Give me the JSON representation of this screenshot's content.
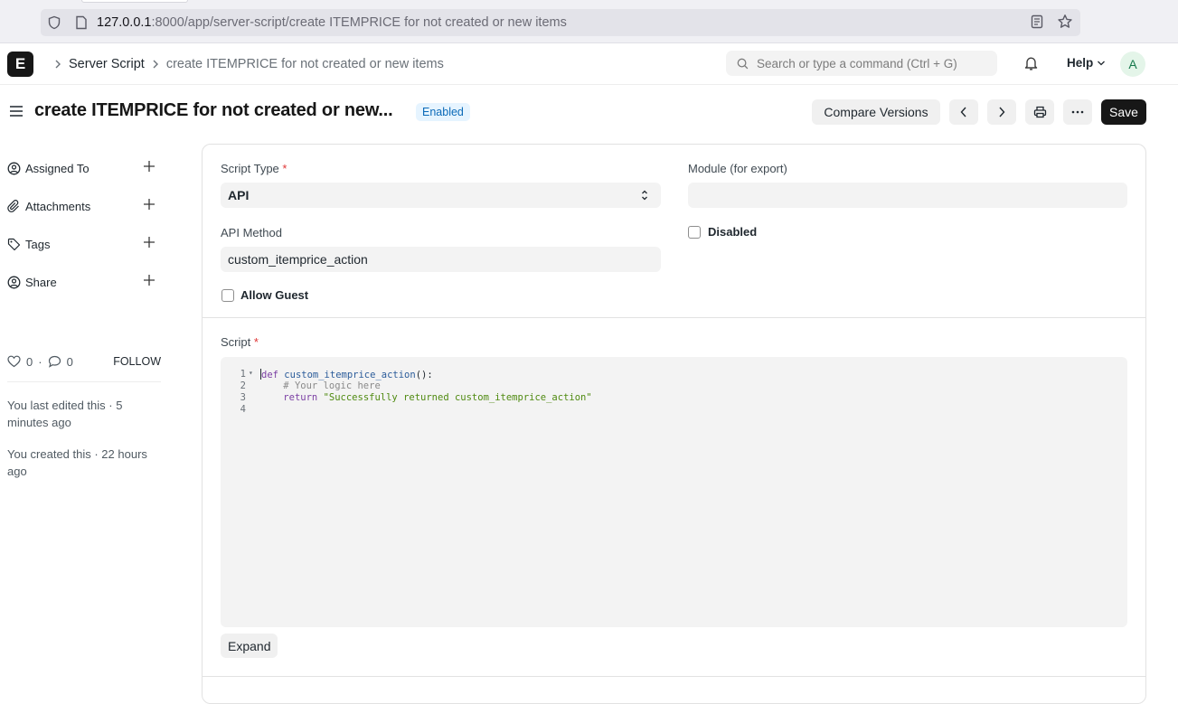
{
  "browser": {
    "url_host": "127.0.0.1",
    "url_rest": ":8000/app/server-script/create ITEMPRICE for not created or new items"
  },
  "navbar": {
    "logo_letter": "E",
    "breadcrumb_1": "Server Script",
    "breadcrumb_2": "create ITEMPRICE for not created or new items",
    "search_placeholder": "Search or type a command (Ctrl + G)",
    "help_label": "Help",
    "avatar_letter": "A"
  },
  "page": {
    "title": "create ITEMPRICE for not created or new...",
    "status": "Enabled",
    "compare_label": "Compare Versions",
    "save_label": "Save"
  },
  "sidebar": {
    "items": [
      {
        "label": "Assigned To",
        "icon": "assign-icon"
      },
      {
        "label": "Attachments",
        "icon": "paperclip-icon"
      },
      {
        "label": "Tags",
        "icon": "tag-icon"
      },
      {
        "label": "Share",
        "icon": "share-icon"
      }
    ],
    "likes": "0",
    "comments": "0",
    "follow_label": "FOLLOW",
    "edited_note": "You last edited this · 5 minutes ago",
    "created_note": "You created this · 22 hours ago"
  },
  "form": {
    "script_type_label": "Script Type",
    "script_type_value": "API",
    "module_label": "Module (for export)",
    "module_value": "",
    "api_method_label": "API Method",
    "api_method_value": "custom_itemprice_action",
    "disabled_label": "Disabled",
    "allow_guest_label": "Allow Guest",
    "script_label": "Script",
    "expand_label": "Expand"
  },
  "editor": {
    "line_numbers": [
      "1",
      "2",
      "3",
      "4"
    ],
    "line1_kw": "def",
    "line1_fn": "custom_itemprice_action",
    "line1_tail": "():",
    "line2_comment": "# Your logic here",
    "line3_kw": "return",
    "line3_str": "\"Successfully returned custom_itemprice_action\""
  }
}
